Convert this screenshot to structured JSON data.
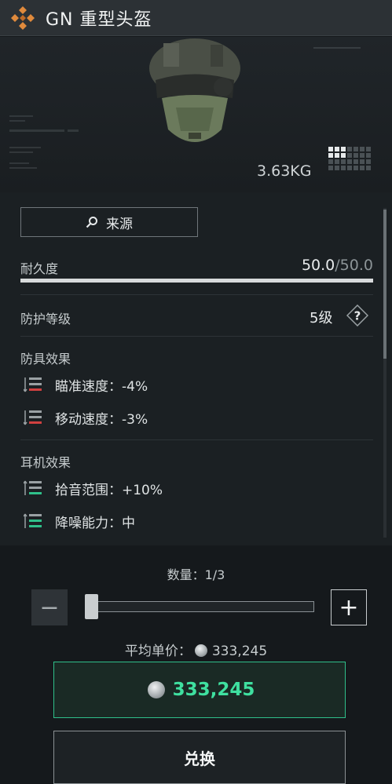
{
  "header": {
    "title": "GN 重型头盔",
    "logo_icon": "diamond-logo-icon",
    "accent_color": "#e08a3c"
  },
  "preview": {
    "weight": "3.63KG",
    "grid_icon": "grid-size-icon"
  },
  "info": {
    "source_label": "来源",
    "durability_label": "耐久度",
    "durability_current": "50.0",
    "durability_max": "/50.0",
    "durability_fraction": 1.0,
    "protection_label": "防护等级",
    "protection_value": "5级",
    "help_label": "?",
    "armor_section_title": "防具效果",
    "armor_effects": [
      {
        "text": "瞄准速度：-4%",
        "icon": "debuff-icon",
        "color": "#d04040"
      },
      {
        "text": "移动速度：-3%",
        "icon": "debuff-icon",
        "color": "#d04040"
      }
    ],
    "headset_section_title": "耳机效果",
    "headset_effects": [
      {
        "text": "拾音范围：+10%",
        "icon": "buff-icon",
        "color": "#2fc08a"
      },
      {
        "text": "降噪能力：中",
        "icon": "buff-icon",
        "color": "#2fc08a"
      }
    ]
  },
  "trade": {
    "quantity_label": "数量：1/3",
    "quantity_fraction": 0.0,
    "minus_label": "−",
    "plus_label": "+",
    "avg_price_label": "平均单价：",
    "avg_price_value": "333,245",
    "total_price": "333,245",
    "exchange_label": "兑换",
    "price_color": "#3fe0a0"
  }
}
